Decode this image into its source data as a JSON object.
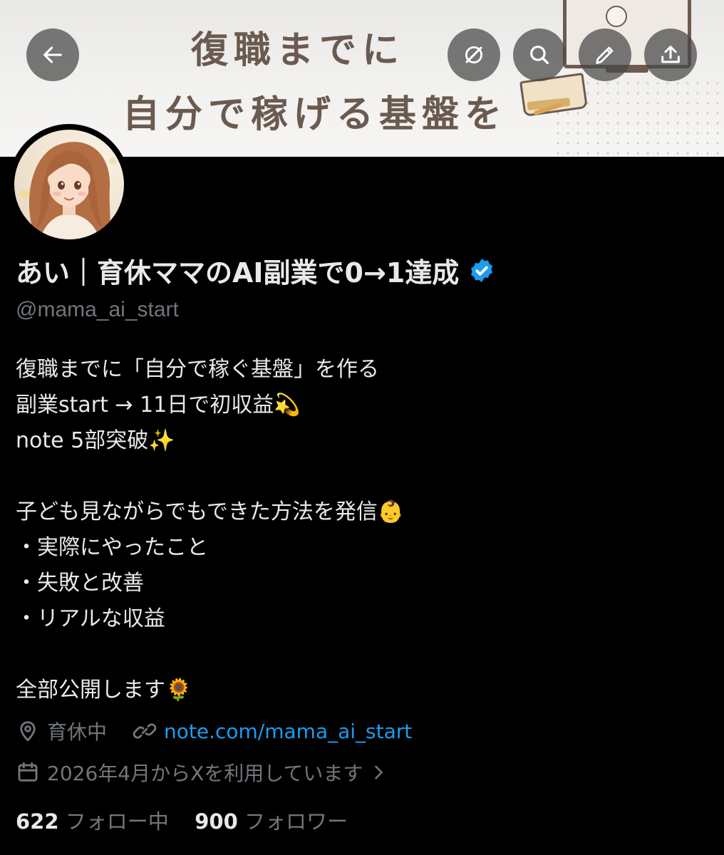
{
  "banner": {
    "line1": "復職までに",
    "line2": "自分で稼げる基盤を"
  },
  "header": {
    "back_icon": "arrow-left-icon",
    "grok_icon": "slashed-circle-icon",
    "search_icon": "search-icon",
    "edit_icon": "pencil-icon",
    "share_icon": "share-upload-icon"
  },
  "profile": {
    "display_name": "あい｜育休ママのAI副業で0→1達成",
    "verified": true,
    "verified_color": "#1d9bf0",
    "handle": "@mama_ai_start",
    "bio_lines": [
      "復職までに「自分で稼ぐ基盤」を作る",
      "副業start → 11日で初収益💫",
      "note 5部突破✨",
      "",
      "子ども見ながらでもできた方法を発信👶",
      "・実際にやったこと",
      "・失敗と改善",
      "・リアルな収益",
      "",
      "全部公開します🌻"
    ],
    "location": "育休中",
    "link": "note.com/mama_ai_start",
    "joined": "2026年4月からXを利用しています",
    "following_count": "622",
    "following_label": "フォロー中",
    "followers_count": "900",
    "followers_label": "フォロワー"
  },
  "colors": {
    "background": "#000000",
    "text_primary": "#e7e9ea",
    "text_secondary": "#71767b",
    "link": "#1d9bf0"
  }
}
